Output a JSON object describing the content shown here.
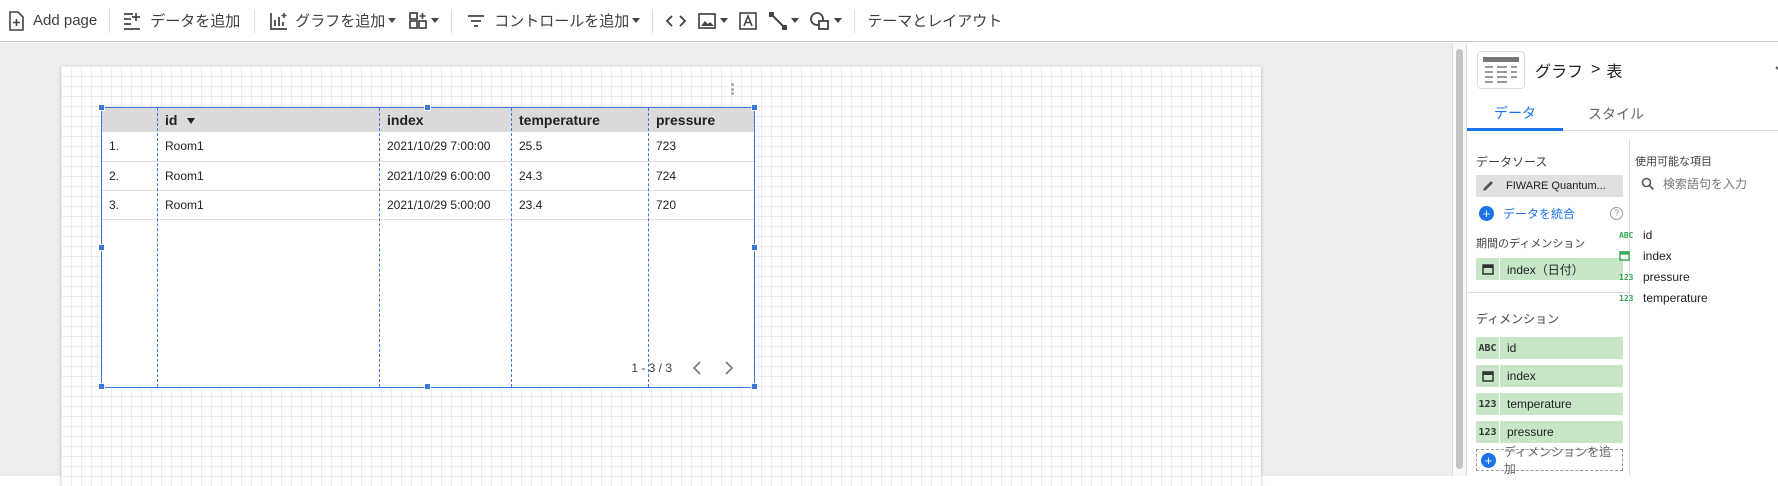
{
  "toolbar": {
    "add_page": "Add page",
    "add_data": "データを追加",
    "add_chart": "グラフを追加",
    "add_control": "コントロールを追加",
    "theme_layout": "テーマとレイアウト"
  },
  "table": {
    "columns": [
      "",
      "id",
      "index",
      "temperature",
      "pressure"
    ],
    "rows": [
      {
        "num": "1.",
        "id": "Room1",
        "index": "2021/10/29 7:00:00",
        "temperature": "25.5",
        "pressure": "723"
      },
      {
        "num": "2.",
        "id": "Room1",
        "index": "2021/10/29 6:00:00",
        "temperature": "24.3",
        "pressure": "724"
      },
      {
        "num": "3.",
        "id": "Room1",
        "index": "2021/10/29 5:00:00",
        "temperature": "23.4",
        "pressure": "720"
      }
    ],
    "pagination": "1 - 3 / 3"
  },
  "panel": {
    "breadcrumb_parent": "グラフ",
    "breadcrumb_sep": ">",
    "breadcrumb_current": "表",
    "tabs": [
      "データ",
      "スタイル"
    ],
    "active_tab": "データ",
    "data_source_title": "データソース",
    "data_source_name": "FIWARE Quantum...",
    "blend_data": "データを統合",
    "date_dimension_title": "期間のディメンション",
    "date_dimension": "index（日付）",
    "dimension_title": "ディメンション",
    "dimensions": [
      {
        "type": "ABC",
        "name": "id"
      },
      {
        "type": "calendar",
        "name": "index"
      },
      {
        "type": "123",
        "name": "temperature"
      },
      {
        "type": "123",
        "name": "pressure"
      }
    ],
    "add_dimension": "ディメンションを追加",
    "available_title": "使用可能な項目",
    "search_placeholder": "検索語句を入力",
    "available_fields": [
      {
        "type": "ABC",
        "name": "id"
      },
      {
        "type": "calendar",
        "name": "index"
      },
      {
        "type": "123",
        "name": "pressure"
      },
      {
        "type": "123",
        "name": "temperature"
      }
    ]
  },
  "colors": {
    "accent": "#1a73e8",
    "selection": "#3c78d8",
    "chip_green": "#c7e6c7",
    "header_grey": "#dadada"
  }
}
